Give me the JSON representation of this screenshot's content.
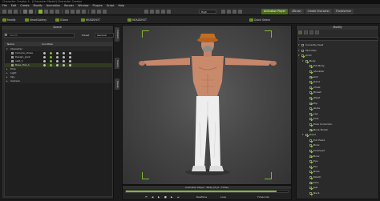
{
  "window": {
    "title": "Character Creator 4 - [Character Model] Character Creator"
  },
  "menu": [
    "File",
    "Edit",
    "Create",
    "Modify",
    "Animation",
    "Render",
    "Window",
    "Plugins",
    "Script",
    "Help"
  ],
  "toolbar": {
    "quality_dropdown": "High",
    "tabs": [
      {
        "label": "Animation Player",
        "active": true
      },
      {
        "label": "ZBrush",
        "active": false
      },
      {
        "label": "Create Character",
        "active": false
      },
      {
        "label": "Transformer",
        "active": false
      }
    ]
  },
  "toolbar2": [
    "Modify",
    "SmartGallery",
    "iClone",
    "HEADSHOT",
    "HEADSHOT",
    "Quick Select"
  ],
  "left_panel": {
    "title": "Scene",
    "search_placeholder": "Search",
    "preset_label": "Preset",
    "preset_value": "General",
    "columns": [
      "Name",
      "Condition"
    ],
    "rows": [
      {
        "label": "Character",
        "indent": 0,
        "expanded": true,
        "type": "section"
      },
      {
        "label": "Camera_shoes",
        "indent": 2,
        "selected": false
      },
      {
        "label": "Design_pant",
        "indent": 2,
        "selected": false
      },
      {
        "label": "vest_1",
        "indent": 2,
        "selected": false
      },
      {
        "label": "Base_Hat_A",
        "indent": 2,
        "selected": true
      },
      {
        "label": "Prop",
        "indent": 0,
        "expanded": false,
        "type": "section"
      },
      {
        "label": "Light",
        "indent": 0,
        "expanded": false,
        "type": "section"
      },
      {
        "label": "Sky",
        "indent": 0,
        "expanded": false,
        "type": "section"
      },
      {
        "label": "Camera",
        "indent": 0,
        "expanded": false,
        "type": "section"
      }
    ]
  },
  "side_tabs": [
    "Content",
    "Scene",
    "Visual"
  ],
  "timeline": {
    "title": "Animation Player : Male_CH_D - T-Pose",
    "progress": 0.93,
    "controls": [
      "Realtime",
      "Loop",
      "Timecode"
    ]
  },
  "right_panel": {
    "title": "Modify",
    "tree": [
      {
        "label": "Currently Used",
        "indent": 0,
        "check": false,
        "arrow": true
      },
      {
        "label": "Favorites",
        "indent": 0,
        "check": false,
        "arrow": true
      },
      {
        "label": "Actor",
        "indent": 0,
        "check": true,
        "arrow": true
      },
      {
        "label": "Body",
        "indent": 1,
        "check": true,
        "arrow": true
      },
      {
        "label": "Full Body",
        "indent": 2,
        "check": true
      },
      {
        "label": "Shoulder",
        "indent": 2,
        "check": true
      },
      {
        "label": "Arm",
        "indent": 2,
        "check": true
      },
      {
        "label": "Hand",
        "indent": 2,
        "check": true
      },
      {
        "label": "Chest",
        "indent": 2,
        "check": true
      },
      {
        "label": "Breast",
        "indent": 2,
        "check": true
      },
      {
        "label": "Waist",
        "indent": 2,
        "check": true
      },
      {
        "label": "Hip",
        "indent": 2,
        "check": true
      },
      {
        "label": "Glute",
        "indent": 2,
        "check": true
      },
      {
        "label": "Leg",
        "indent": 2,
        "check": true
      },
      {
        "label": "Foot",
        "indent": 2,
        "check": true
      },
      {
        "label": "Pose Correction",
        "indent": 2,
        "check": true
      },
      {
        "label": "Bone Morph",
        "indent": 2,
        "check": true
      },
      {
        "label": "Head",
        "indent": 1,
        "check": true,
        "arrow": true
      },
      {
        "label": "Full Head",
        "indent": 2,
        "check": true
      },
      {
        "label": "Brow",
        "indent": 2,
        "check": true
      },
      {
        "label": "Forehead",
        "indent": 2,
        "check": true
      },
      {
        "label": "Brow",
        "indent": 2,
        "check": true
      },
      {
        "label": "Eye",
        "indent": 2,
        "check": true
      },
      {
        "label": "Ear",
        "indent": 2,
        "check": true
      },
      {
        "label": "Nose",
        "indent": 2,
        "check": true
      },
      {
        "label": "Mouth",
        "indent": 2,
        "check": true
      },
      {
        "label": "Chin",
        "indent": 2,
        "check": true
      },
      {
        "label": "Jaw",
        "indent": 2,
        "check": true
      },
      {
        "label": "Neck",
        "indent": 2,
        "check": true
      }
    ]
  },
  "colors": {
    "accent": "#7fb832",
    "tab_active": "#4b6a1a",
    "panel_bg": "#2a2a2a",
    "viewport_center": "#5c5c5c"
  }
}
